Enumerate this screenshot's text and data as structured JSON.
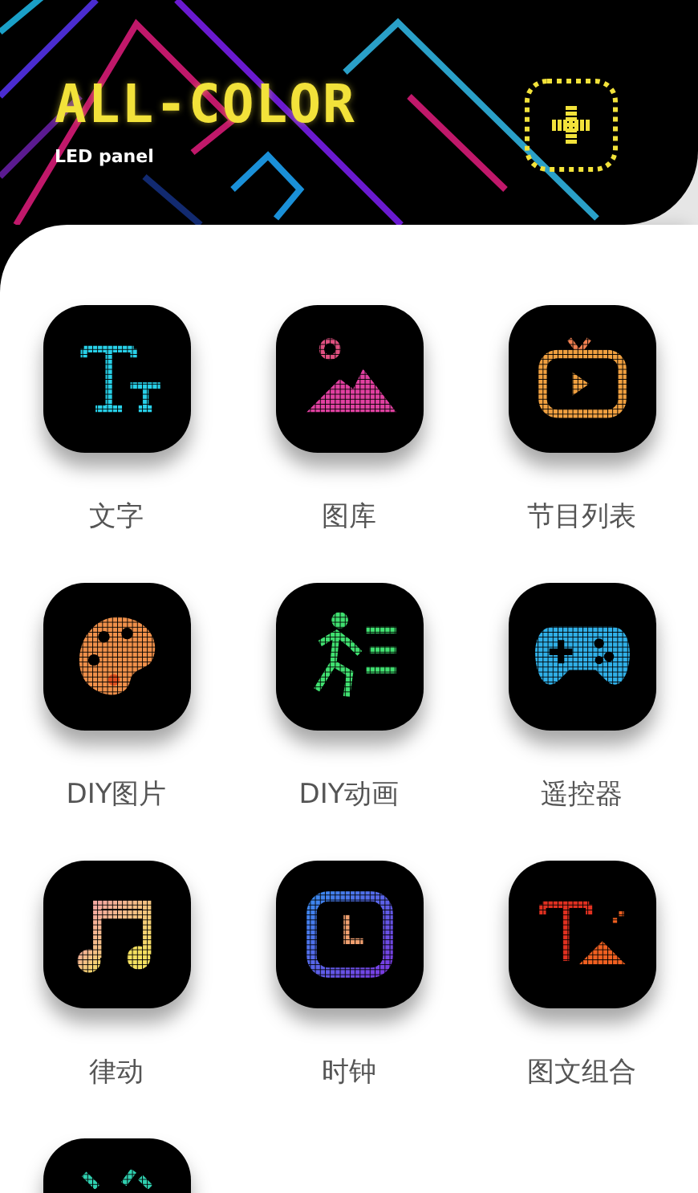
{
  "header": {
    "logo": "ALL-COLOR",
    "subtitle": "LED panel"
  },
  "tiles": [
    {
      "label": "文字",
      "partial": false
    },
    {
      "label": "图库",
      "partial": false
    },
    {
      "label": "节目列表",
      "partial": false
    },
    {
      "label": "DIY图片",
      "partial": false
    },
    {
      "label": "DIY动画",
      "partial": false
    },
    {
      "label": "遥控器",
      "partial": false
    },
    {
      "label": "律动",
      "partial": false
    },
    {
      "label": "时钟",
      "partial": false
    },
    {
      "label": "图文组合",
      "partial": false
    },
    {
      "partial": true
    }
  ]
}
